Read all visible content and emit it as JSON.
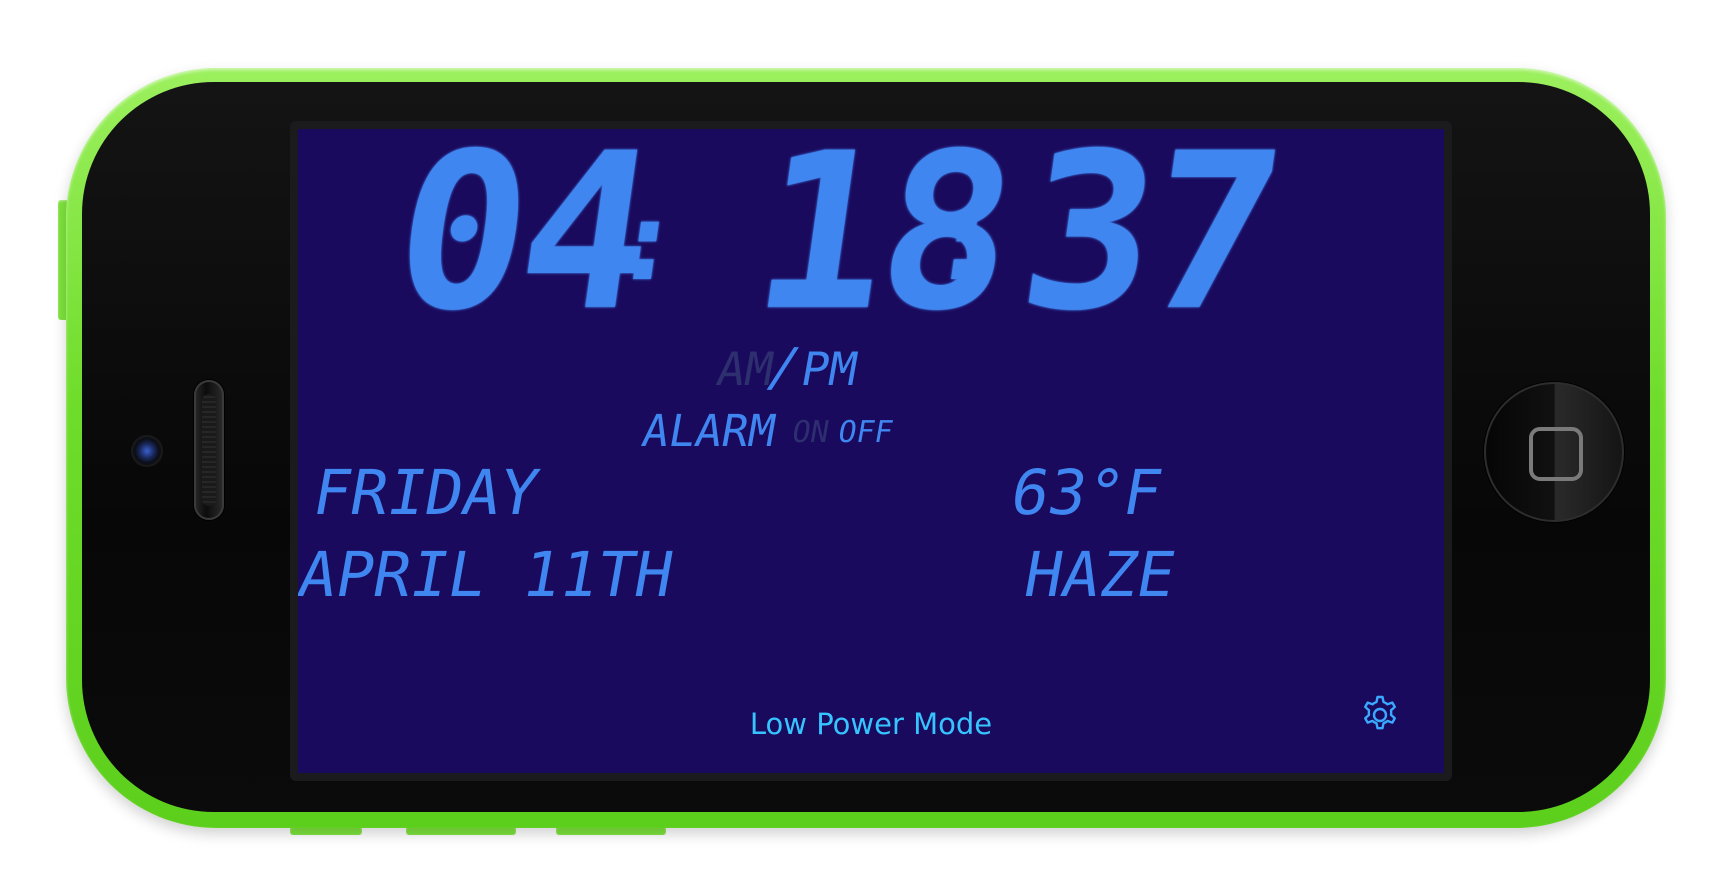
{
  "clock": {
    "hours": "04",
    "minutes": "18",
    "seconds": "37",
    "separator": ":"
  },
  "meridiem": {
    "am_label": "AM",
    "slash": "/",
    "pm_label": "PM",
    "active": "PM"
  },
  "alarm": {
    "label": "ALARM",
    "on_label": "ON",
    "off_label": "OFF",
    "active": "OFF"
  },
  "date": {
    "weekday": "FRIDAY",
    "month_day": "APRIL 11TH"
  },
  "weather": {
    "temperature": "63°F",
    "condition": "HAZE"
  },
  "footer": {
    "low_power_label": "Low Power Mode"
  },
  "icons": {
    "settings": "gear-icon"
  },
  "colors": {
    "screen_background": "#1a0a5e",
    "lcd_segment_lit": "#3f86f0",
    "lcd_segment_dim": "#2d2f6e",
    "link_text": "#36c4ff",
    "phone_shell": "#72dd30"
  }
}
